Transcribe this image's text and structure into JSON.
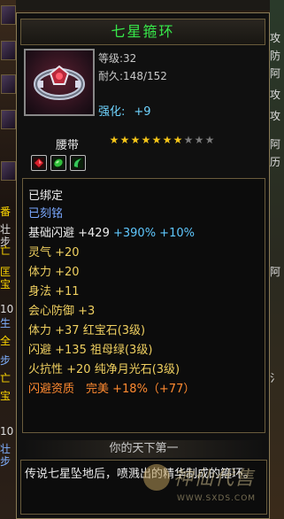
{
  "item": {
    "name": "七星箍环",
    "level": "等级:32",
    "durability": "耐久:148/152",
    "enhance_label": "强化:",
    "enhance_value": "+9",
    "category": "腰带",
    "stars_total": 10,
    "stars_filled": 7
  },
  "sockets": [
    {
      "name": "ruby-socket-icon",
      "color": "#d81e2a"
    },
    {
      "name": "emerald-socket-icon",
      "color": "#2fbf3a"
    },
    {
      "name": "moonstone-socket-icon",
      "color": "#35c85a"
    }
  ],
  "attributes": [
    {
      "text": "已绑定",
      "color": "white"
    },
    {
      "text": "已刻铭",
      "color": "blue"
    },
    {
      "text": "基础闪避 +429 +390% +10%",
      "color": "white"
    },
    {
      "text": "灵气 +20",
      "color": "yellow"
    },
    {
      "text": "体力 +20",
      "color": "yellow"
    },
    {
      "text": "身法 +11",
      "color": "yellow"
    },
    {
      "text": "会心防御 +3",
      "color": "yellow"
    },
    {
      "text": "体力 +37 红宝石(3级)",
      "color": "yellow"
    },
    {
      "text": "闪避 +135 祖母绿(3级)",
      "color": "yellow"
    },
    {
      "text": "火抗性 +20 纯净月光石(3级)",
      "color": "yellow"
    },
    {
      "text": "闪避资质　完美 +18%（+77）",
      "color": "orange"
    }
  ],
  "section_title": "你的天下第一",
  "description": "传说七星坠地后，喷溅出的精华制成的箍环。",
  "watermark": {
    "text": "神仙代售",
    "url": "WWW.SXDS.COM"
  },
  "background_ui": {
    "left_labels": [
      "番",
      "壮步",
      "亡",
      "匡宝",
      "10",
      "生",
      "全",
      "步",
      "亡",
      "宝",
      "10",
      "壮步"
    ],
    "right_labels": [
      "攻",
      "防",
      "阿",
      "攻",
      "攻",
      "阿",
      "历",
      "阿",
      "氵"
    ]
  },
  "colors": {
    "title_green": "#37e84a",
    "border_gold": "#8a7a55",
    "enhance_cyan": "#6fd4ff",
    "attr_yellow": "#f0d060",
    "qual_orange": "#ff8a30",
    "engraved_blue": "#7aa8ff"
  }
}
